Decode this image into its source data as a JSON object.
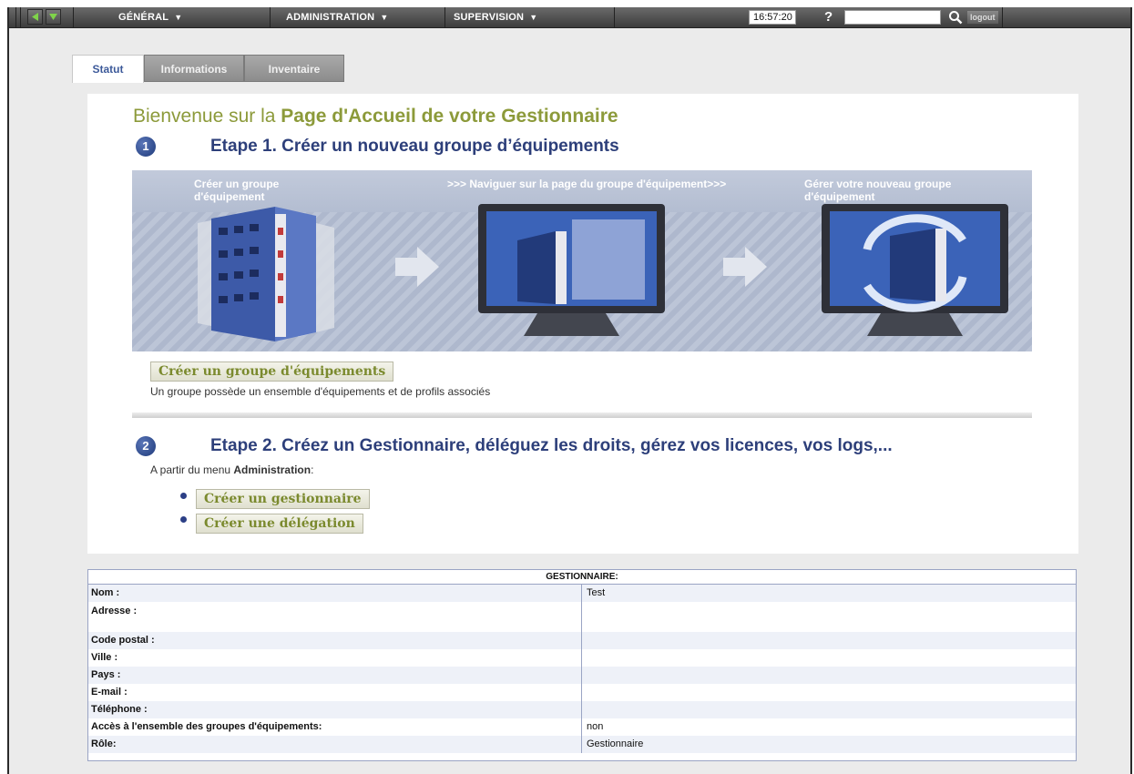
{
  "topbar": {
    "menus": [
      {
        "label": "GÉNÉRAL"
      },
      {
        "label": "ADMINISTRATION"
      },
      {
        "label": "SUPERVISION"
      }
    ],
    "time": "16:57:20",
    "help_label": "?",
    "search_value": "",
    "logout_label": "logout"
  },
  "tabs": [
    {
      "label": "Statut",
      "active": true
    },
    {
      "label": "Informations",
      "active": false
    },
    {
      "label": "Inventaire",
      "active": false
    }
  ],
  "main": {
    "welcome_prefix": "Bienvenue sur la ",
    "welcome_bold": "Page d'Accueil de votre Gestionnaire",
    "step1": {
      "number": "1",
      "title": "Etape 1. Créer un nouveau groupe d’équipements",
      "banner_texts": [
        "Créer un groupe\nd'équipement",
        ">>>  Naviguer sur la page du groupe d'équipement>>>",
        "Gérer votre nouveau groupe\nd'équipement"
      ],
      "button_label": "Créer un groupe d'équipements",
      "description": "Un groupe possède un ensemble d'équipements et de profils associés"
    },
    "step2": {
      "number": "2",
      "title": "Etape 2. Créez un Gestionnaire, déléguez les droits, gérez vos licences, vos logs,...",
      "intro_prefix": "A partir du menu ",
      "intro_bold": "Administration",
      "intro_suffix": ":",
      "buttons": [
        {
          "label": "Créer un gestionnaire"
        },
        {
          "label": "Créer une délégation"
        }
      ]
    }
  },
  "manager": {
    "header": "GESTIONNAIRE:",
    "rows": [
      {
        "key": "Nom :",
        "value": "Test"
      },
      {
        "key": "Adresse :",
        "value": ""
      },
      {
        "key": "Code postal :",
        "value": ""
      },
      {
        "key": "Ville :",
        "value": ""
      },
      {
        "key": "Pays :",
        "value": ""
      },
      {
        "key": "E-mail :",
        "value": ""
      },
      {
        "key": "Téléphone :",
        "value": ""
      },
      {
        "key": "Accès à l'ensemble des groupes d'équipements:",
        "value": "non"
      },
      {
        "key": "Rôle:",
        "value": "Gestionnaire"
      }
    ]
  },
  "colors": {
    "accent_blue": "#2d3f7a",
    "welcome_olive": "#8c9a3a",
    "tab_active_text": "#3d5a9a"
  }
}
